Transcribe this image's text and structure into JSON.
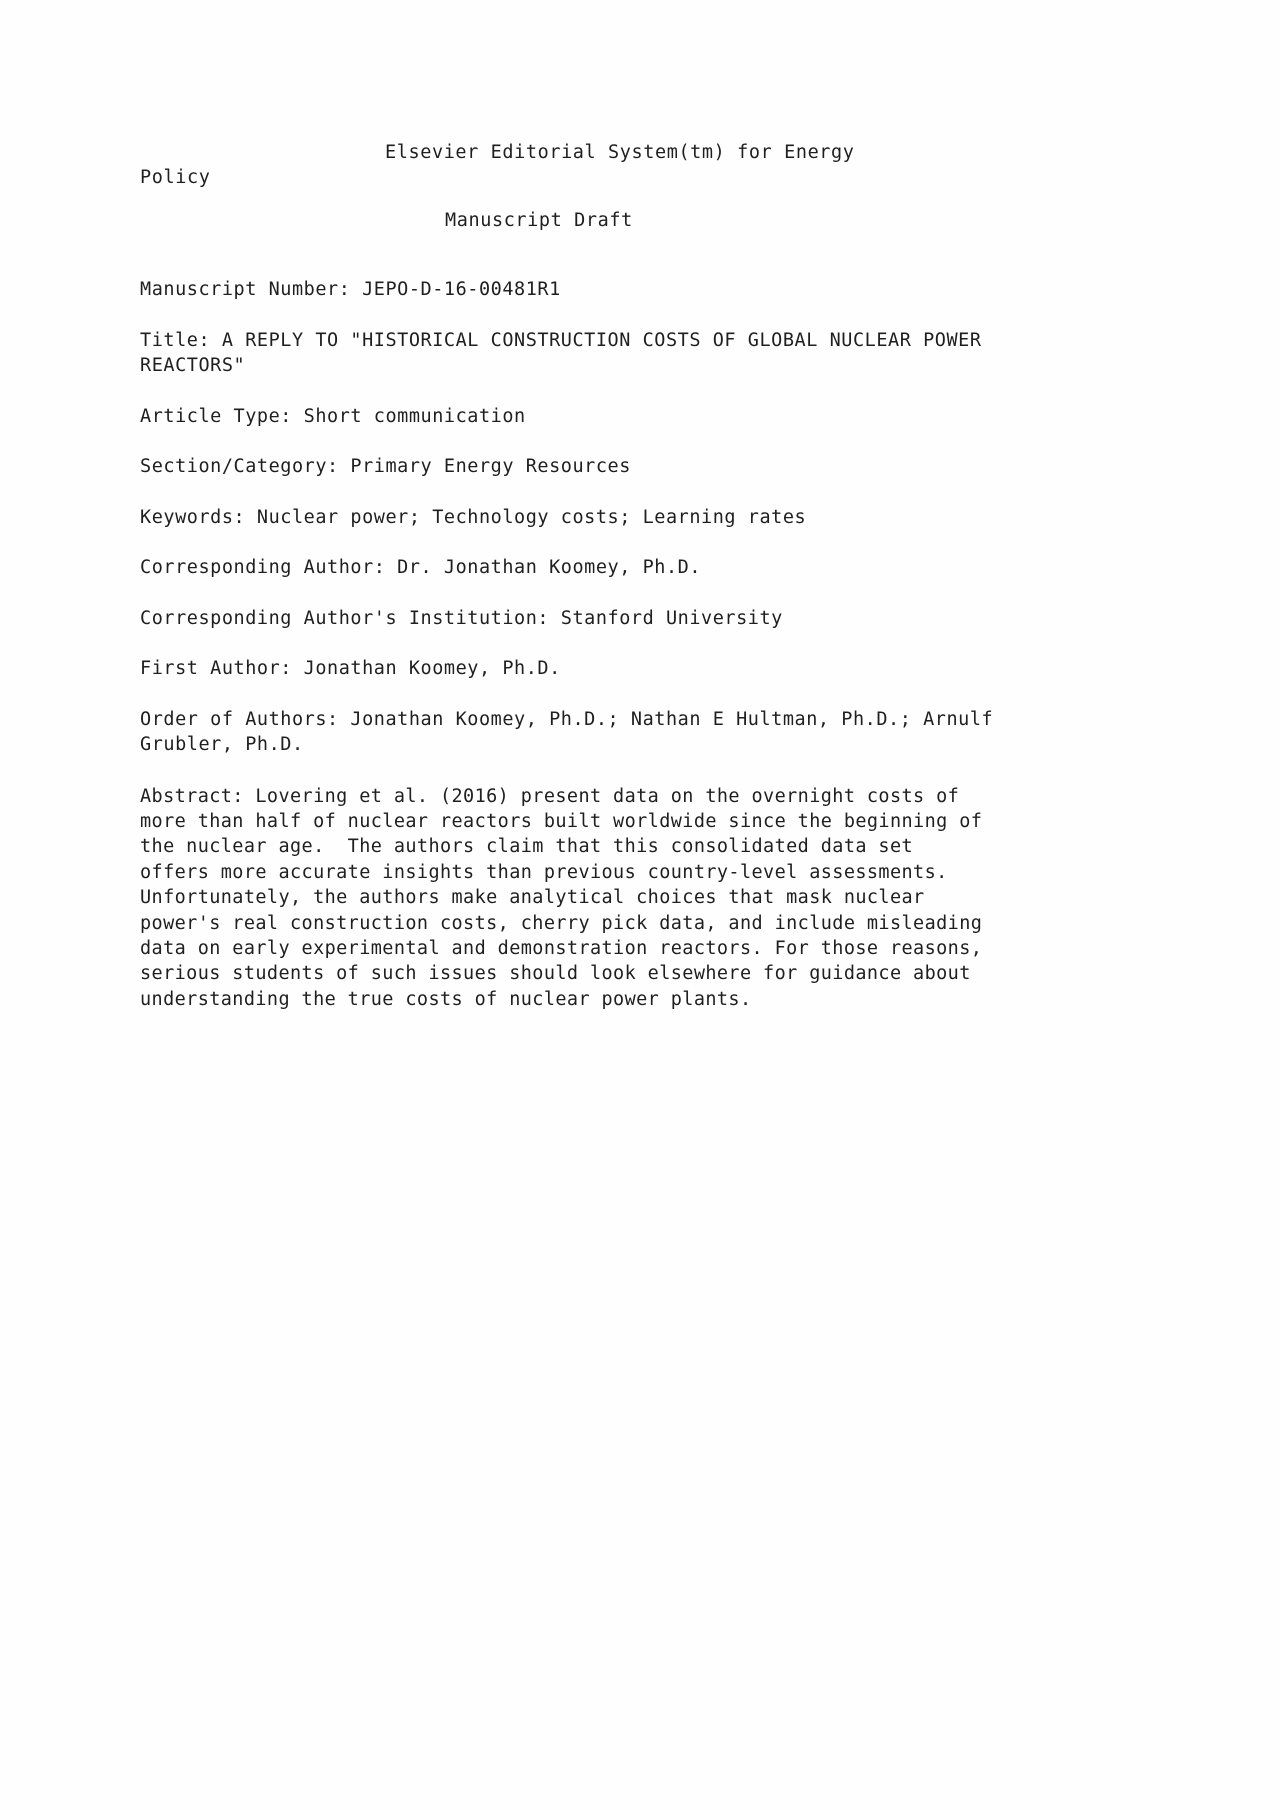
{
  "document": {
    "type": "manuscript-draft-cover-sheet",
    "background_color": "#fefefe",
    "text_color": "#1f1f1f"
  },
  "header": {
    "system_line_1": "Elsevier Editorial System(tm) for Energy",
    "system_line_2": "Policy",
    "draft_label": "Manuscript Draft"
  },
  "fields": {
    "manuscript_number": "Manuscript Number: JEPO-D-16-00481R1",
    "title": "Title: A REPLY TO \"HISTORICAL CONSTRUCTION COSTS OF GLOBAL NUCLEAR POWER\nREACTORS\"",
    "article_type": "Article Type: Short communication",
    "section_category": "Section/Category: Primary Energy Resources",
    "keywords": "Keywords: Nuclear power; Technology costs; Learning rates",
    "corresponding_author": "Corresponding Author: Dr. Jonathan Koomey, Ph.D.",
    "corresponding_author_institution": "Corresponding Author's Institution: Stanford University",
    "first_author": "First Author: Jonathan Koomey, Ph.D.",
    "order_of_authors": "Order of Authors: Jonathan Koomey, Ph.D.; Nathan E Hultman, Ph.D.; Arnulf\nGrubler, Ph.D."
  },
  "abstract": {
    "text": "Abstract: Lovering et al. (2016) present data on the overnight costs of\nmore than half of nuclear reactors built worldwide since the beginning of\nthe nuclear age.  The authors claim that this consolidated data set\noffers more accurate insights than previous country-level assessments.\nUnfortunately, the authors make analytical choices that mask nuclear\npower's real construction costs, cherry pick data, and include misleading\ndata on early experimental and demonstration reactors. For those reasons,\nserious students of such issues should look elsewhere for guidance about\nunderstanding the true costs of nuclear power plants."
  }
}
